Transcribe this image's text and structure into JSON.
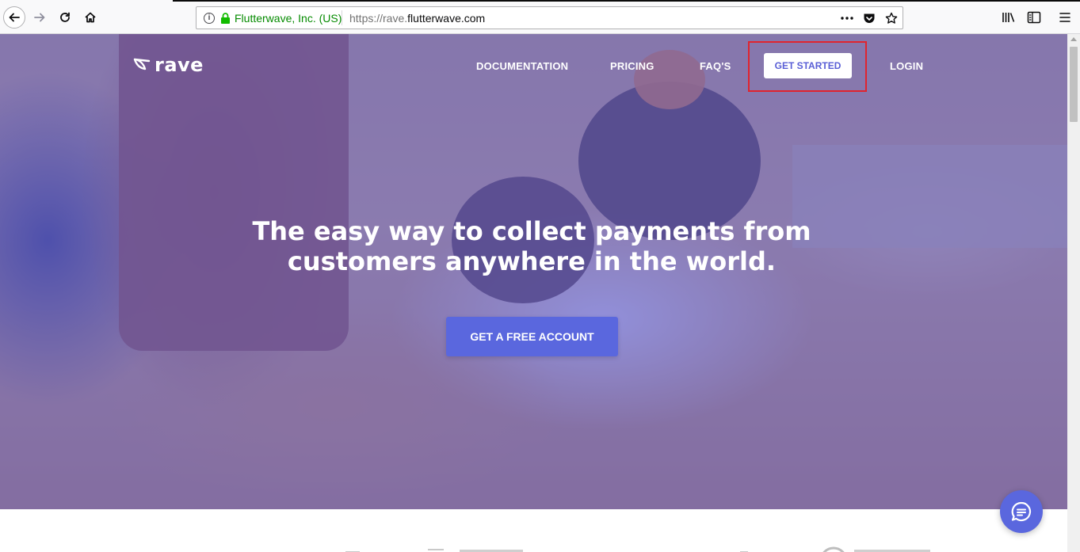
{
  "browser": {
    "site_identity": "Flutterwave, Inc. (US)",
    "url_prefix": "https://rave.",
    "url_domain": "flutterwave.com"
  },
  "nav": {
    "logo_text": "rave",
    "documentation": "DOCUMENTATION",
    "pricing": "PRICING",
    "faqs": "FAQ'S",
    "get_started": "GET STARTED",
    "login": "LOGIN"
  },
  "hero": {
    "headline_line1": "The easy way to collect payments from",
    "headline_line2": "customers anywhere in the world.",
    "cta_label": "GET A FREE ACCOUNT"
  },
  "colors": {
    "accent": "#5a67de",
    "highlight_outline": "#e0242e",
    "overlay": "#5c5cd2"
  },
  "icons": {
    "back": "back-arrow-icon",
    "forward": "forward-arrow-icon",
    "reload": "reload-icon",
    "home": "home-icon",
    "info": "info-icon",
    "lock": "lock-icon",
    "more": "more-dots-icon",
    "pocket": "pocket-icon",
    "bookmark": "star-icon",
    "library": "library-icon",
    "sidebar": "sidebar-icon",
    "menu": "hamburger-menu-icon",
    "chat": "chat-icon"
  }
}
